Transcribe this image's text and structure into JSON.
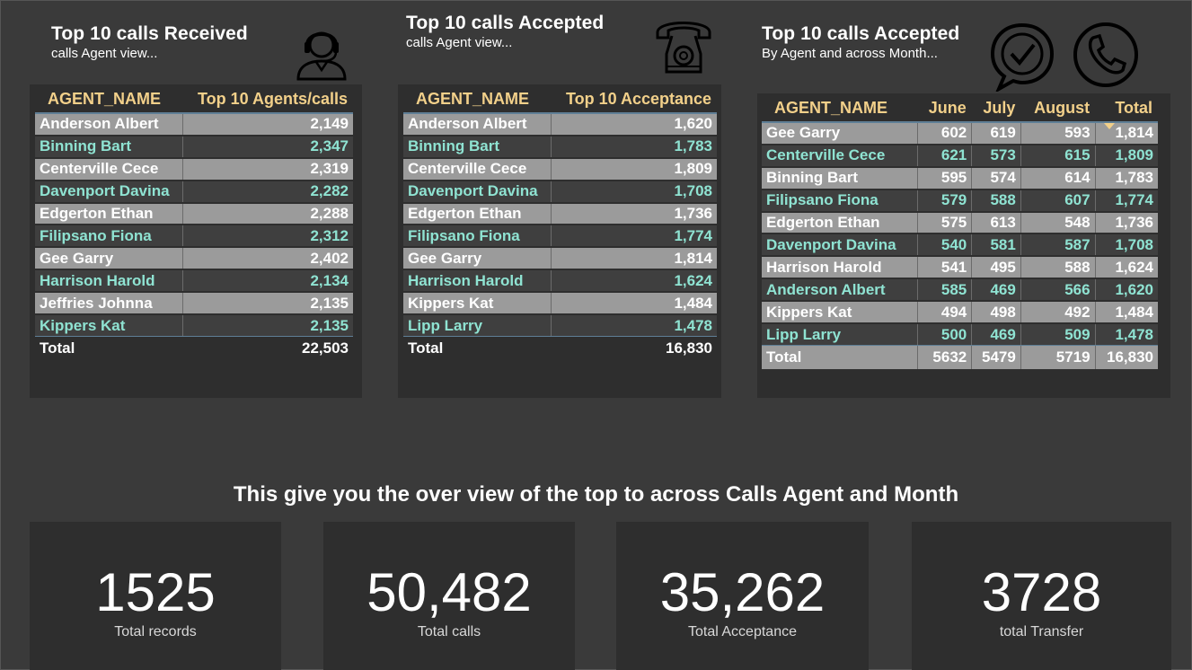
{
  "headings": [
    {
      "title": "Top 10 calls Received",
      "subtitle": "calls Agent view..."
    },
    {
      "title": "Top 10 calls Accepted",
      "subtitle": "calls Agent view..."
    },
    {
      "title": "Top 10 calls Accepted",
      "subtitle": "By Agent and across Month..."
    }
  ],
  "icons": [
    "headset-agent-icon",
    "telephone-icon",
    "chat-check-icon",
    "phone-circle-icon"
  ],
  "table1": {
    "headers": [
      "AGENT_NAME",
      "Top 10 Agents/calls"
    ],
    "rows": [
      [
        "Anderson Albert",
        "2,149"
      ],
      [
        "Binning Bart",
        "2,347"
      ],
      [
        "Centerville Cece",
        "2,319"
      ],
      [
        "Davenport Davina",
        "2,282"
      ],
      [
        "Edgerton Ethan",
        "2,288"
      ],
      [
        "Filipsano Fiona",
        "2,312"
      ],
      [
        "Gee Garry",
        "2,402"
      ],
      [
        "Harrison Harold",
        "2,134"
      ],
      [
        "Jeffries Johnna",
        "2,135"
      ],
      [
        "Kippers Kat",
        "2,135"
      ]
    ],
    "total": [
      "Total",
      "22,503"
    ]
  },
  "table2": {
    "headers": [
      "AGENT_NAME",
      "Top 10 Acceptance"
    ],
    "rows": [
      [
        "Anderson Albert",
        "1,620"
      ],
      [
        "Binning Bart",
        "1,783"
      ],
      [
        "Centerville Cece",
        "1,809"
      ],
      [
        "Davenport Davina",
        "1,708"
      ],
      [
        "Edgerton Ethan",
        "1,736"
      ],
      [
        "Filipsano Fiona",
        "1,774"
      ],
      [
        "Gee Garry",
        "1,814"
      ],
      [
        "Harrison Harold",
        "1,624"
      ],
      [
        "Kippers Kat",
        "1,484"
      ],
      [
        "Lipp Larry",
        "1,478"
      ]
    ],
    "total": [
      "Total",
      "16,830"
    ]
  },
  "table3": {
    "headers": [
      "AGENT_NAME",
      "June",
      "July",
      "August",
      "Total"
    ],
    "sorted_column": "Total",
    "rows": [
      [
        "Gee Garry",
        "602",
        "619",
        "593",
        "1,814"
      ],
      [
        "Centerville Cece",
        "621",
        "573",
        "615",
        "1,809"
      ],
      [
        "Binning Bart",
        "595",
        "574",
        "614",
        "1,783"
      ],
      [
        "Filipsano Fiona",
        "579",
        "588",
        "607",
        "1,774"
      ],
      [
        "Edgerton Ethan",
        "575",
        "613",
        "548",
        "1,736"
      ],
      [
        "Davenport Davina",
        "540",
        "581",
        "587",
        "1,708"
      ],
      [
        "Harrison Harold",
        "541",
        "495",
        "588",
        "1,624"
      ],
      [
        "Anderson Albert",
        "585",
        "469",
        "566",
        "1,620"
      ],
      [
        "Kippers Kat",
        "494",
        "498",
        "492",
        "1,484"
      ],
      [
        "Lipp Larry",
        "500",
        "469",
        "509",
        "1,478"
      ]
    ],
    "total": [
      "Total",
      "5632",
      "5479",
      "5719",
      "16,830"
    ]
  },
  "banner": "This give you the over view of the top to across Calls Agent and Month",
  "cards": [
    {
      "value": "1525",
      "label": "Total records"
    },
    {
      "value": "50,482",
      "label": "Total calls"
    },
    {
      "value": "35,262",
      "label": "Total Acceptance"
    },
    {
      "value": "3728",
      "label": "total Transfer"
    }
  ],
  "colors": {
    "background": "#3a3a3a",
    "panel": "#2e2e2e",
    "header_text": "#f2d08a",
    "alt_row_text": "#8fe3d2",
    "row_grey": "#9b9b9b"
  }
}
